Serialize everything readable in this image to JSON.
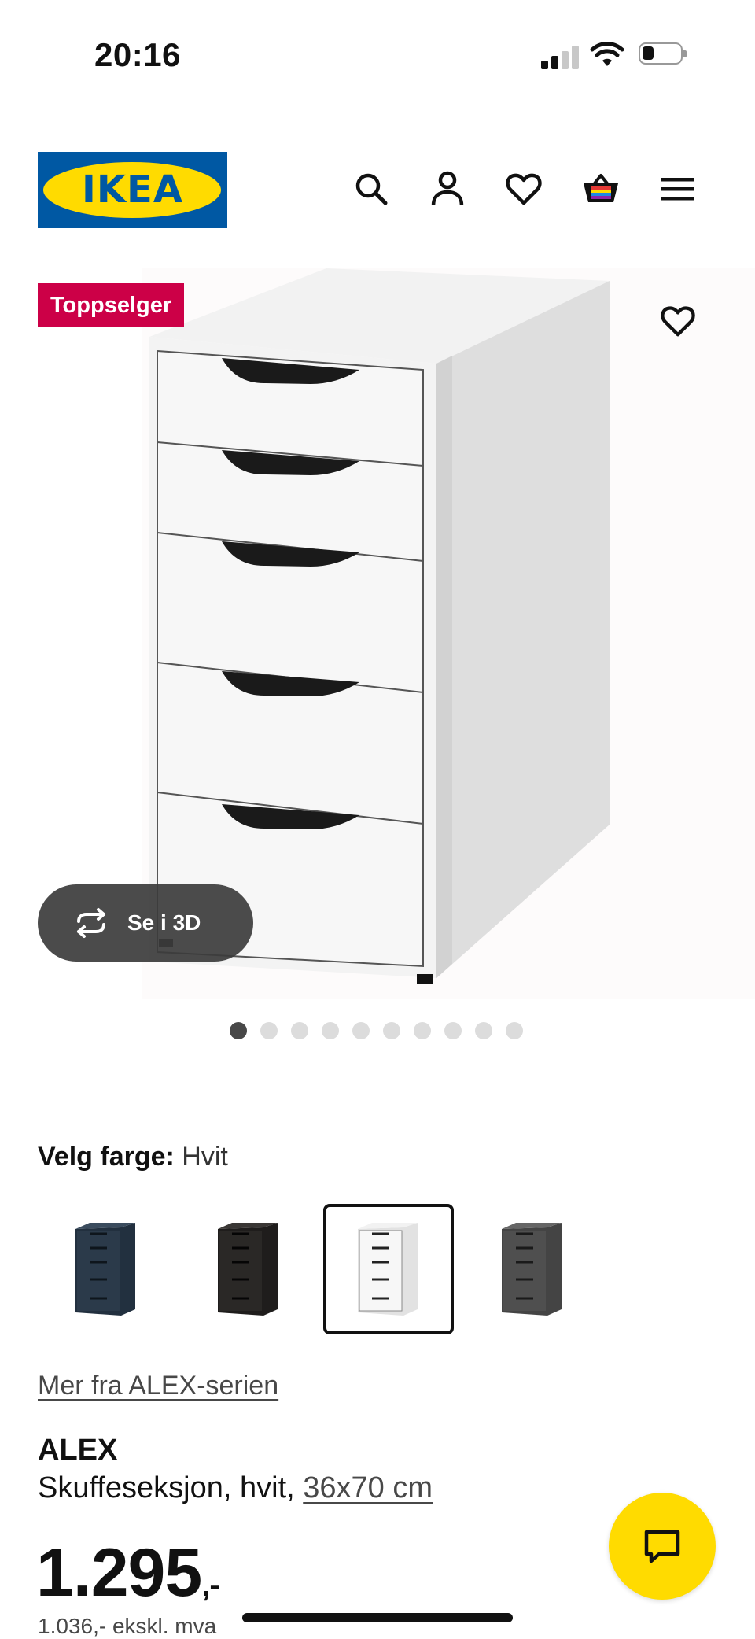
{
  "status_bar": {
    "time": "20:16"
  },
  "header": {
    "logo_text": "IKEA",
    "icons": [
      "search-icon",
      "account-icon",
      "wishlist-heart-icon",
      "cart-basket-icon",
      "menu-hamburger-icon"
    ]
  },
  "gallery": {
    "badge": "Toppselger",
    "view_3d_label": "Se i 3D",
    "image_count": 10,
    "active_image": 1
  },
  "color_picker": {
    "label": "Velg farge:",
    "selected": "Hvit",
    "swatches": [
      {
        "name": "dark blue",
        "color": "#2b3a4a"
      },
      {
        "name": "black-brown",
        "color": "#2a2826"
      },
      {
        "name": "white",
        "color": "#f4f4f4",
        "selected": true
      },
      {
        "name": "grey",
        "color": "#4f4f4f"
      }
    ]
  },
  "series_link": "Mer fra ALEX-serien",
  "product": {
    "name": "ALEX",
    "description": "Skuffeseksjon, hvit, ",
    "size_link": "36x70 cm",
    "price": "1.295",
    "price_suffix": ",-",
    "price_ex_vat": "1.036,- ekskl. mva"
  },
  "colors": {
    "brand_blue": "#0058a3",
    "brand_yellow": "#ffdb00",
    "badge_red": "#cc0047"
  }
}
